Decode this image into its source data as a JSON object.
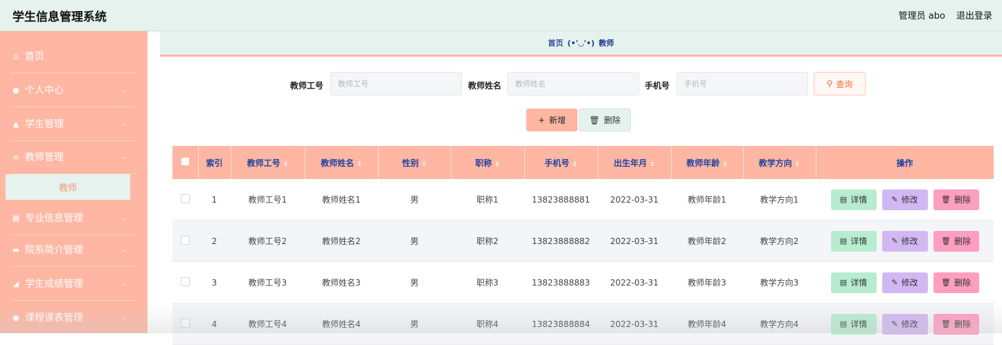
{
  "app": {
    "title": "学生信息管理系统"
  },
  "header": {
    "user_label": "管理员 abo",
    "logout_label": "退出登录"
  },
  "sidebar": {
    "items": [
      {
        "label": "首页",
        "icon": "home-icon",
        "glyph": "⌂",
        "has_chevron": false
      },
      {
        "label": "个人中心",
        "icon": "user-icon",
        "glyph": "●",
        "has_chevron": true
      },
      {
        "label": "学生管理",
        "icon": "student-icon",
        "glyph": "▲",
        "has_chevron": true
      },
      {
        "label": "教师管理",
        "icon": "sliders-icon",
        "glyph": "≡",
        "has_chevron": true
      },
      {
        "label": "专业信息管理",
        "icon": "grid-icon",
        "glyph": "▦",
        "has_chevron": true
      },
      {
        "label": "院系简介管理",
        "icon": "briefcase-icon",
        "glyph": "▬",
        "has_chevron": true
      },
      {
        "label": "学生成绩管理",
        "icon": "chart-icon",
        "glyph": "◢",
        "has_chevron": true
      },
      {
        "label": "课程课表管理",
        "icon": "pin-icon",
        "glyph": "●",
        "has_chevron": true
      }
    ],
    "active_sub": "教师"
  },
  "breadcrumb": {
    "home": "首页",
    "separator": "(•'◡'•)",
    "current": "教师"
  },
  "search": {
    "teacher_no_label": "教师工号",
    "teacher_no_placeholder": "教师工号",
    "teacher_name_label": "教师姓名",
    "teacher_name_placeholder": "教师姓名",
    "phone_label": "手机号",
    "phone_placeholder": "手机号",
    "query_label": "查询"
  },
  "toolbar": {
    "add_label": "新增",
    "delete_label": "删除"
  },
  "table": {
    "columns": [
      "索引",
      "教师工号",
      "教师姓名",
      "性别",
      "职称",
      "手机号",
      "出生年月",
      "教师年龄",
      "教学方向",
      "操作"
    ],
    "rows": [
      [
        "1",
        "教师工号1",
        "教师姓名1",
        "男",
        "职称1",
        "13823888881",
        "2022-03-31",
        "教师年龄1",
        "教学方向1"
      ],
      [
        "2",
        "教师工号2",
        "教师姓名2",
        "男",
        "职称2",
        "13823888882",
        "2022-03-31",
        "教师年龄2",
        "教学方向2"
      ],
      [
        "3",
        "教师工号3",
        "教师姓名3",
        "男",
        "职称3",
        "13823888883",
        "2022-03-31",
        "教师年龄3",
        "教学方向3"
      ],
      [
        "4",
        "教师工号4",
        "教师姓名4",
        "男",
        "职称4",
        "13823888884",
        "2022-03-31",
        "教师年龄4",
        "教学方向4"
      ]
    ],
    "actions": {
      "detail": "详情",
      "edit": "修改",
      "delete": "删除"
    }
  },
  "colors": {
    "accent": "#ffb7a3",
    "header_bg": "#e6f2ee",
    "detail_btn": "#b8ecd0",
    "edit_btn": "#d2b8f2",
    "delete_btn": "#ff9fc0"
  }
}
